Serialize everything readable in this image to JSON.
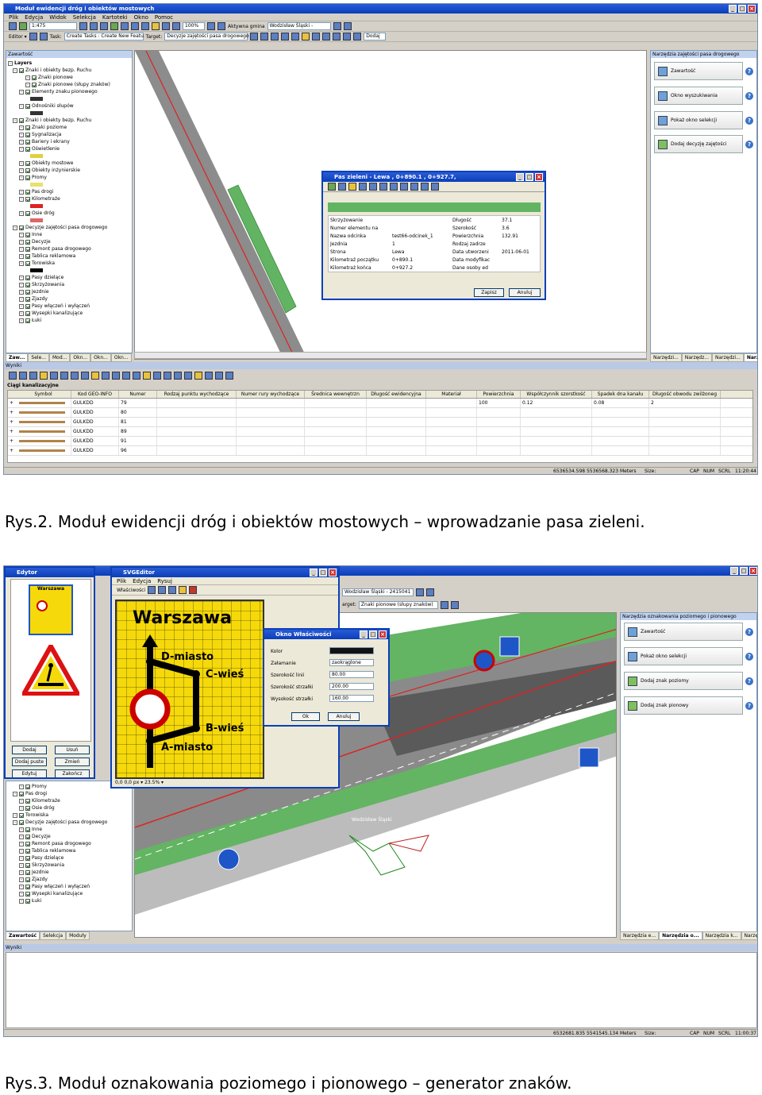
{
  "figure1": {
    "window_title": "Moduł ewidencji dróg i obiektów mostowych",
    "menu": [
      "Plik",
      "Edycja",
      "Widok",
      "Selekcja",
      "Kartoteki",
      "Okno",
      "Pomoc"
    ],
    "scale": "1:475",
    "zoom": "100%",
    "toolbar_active_gmina_label": "Aktywna gmina",
    "toolbar_active_gmina_value": "Wodzisław Śląski -",
    "editor_label": "Editor ▾",
    "task_label": "Task:",
    "task_value": "Create Tasks : Create New Featu",
    "target_label": "Target:",
    "target_value": "Decyzje zajętości pasa drogowego",
    "dodaj_label": "Dodaj",
    "toc_header": "Zawartość",
    "toc_root": "Layers",
    "toc_items": [
      "Znaki i obiekty bezp. Ruchu",
      "Znaki pionowe",
      "Znaki pionowe (słupy znaków)",
      "Elementy znaku pionowego",
      "Odnośniki słupów",
      "Znaki i obiekty bezp. Ruchu",
      "Znaki poziome",
      "Sygnalizacja",
      "Bariery i ekrany",
      "Oświetlenie",
      "Obiekty mostowe",
      "Obiekty inżynierskie",
      "Promy",
      "Pas drogi",
      "Kilometraże",
      "Osie dróg",
      "Decyzje zajętości pasa drogowego",
      "Inne",
      "Decyzje",
      "Remont pasa drogowego",
      "Tablica reklamowa",
      "Torowiska",
      "Pasy dzielące",
      "Skrzyżowania",
      "Jezdnie",
      "Zjazdy",
      "Pasy włączeń i wyłączeń",
      "Wysepki kanalizujące",
      "Łuki"
    ],
    "toc_tabs": [
      "Zaw...",
      "Sele...",
      "Mod...",
      "Okn...",
      "Okn...",
      "Okn..."
    ],
    "right_panel_title": "Narzędzia zajętości pasa drogowego",
    "right_buttons": [
      "Zawartość",
      "Okno wyszukiwania",
      "Pokaż okno selekcji",
      "Dodaj decyzję zajętości"
    ],
    "right_tabs": [
      "Narzędzi...",
      "Narzędz...",
      "Narzędzi...",
      "Narzędzi..."
    ],
    "dialog": {
      "title": "Pas zieleni - Lewa , 0+890.1 , 0+927.7,",
      "left_fields": [
        {
          "label": "Skrzyżowanie",
          "value": ""
        },
        {
          "label": "Numer elementu na",
          "value": ""
        },
        {
          "label": "Nazwa odcinka",
          "value": "test66-odcinek_1"
        },
        {
          "label": "Jezdnia",
          "value": "1"
        },
        {
          "label": "Strona",
          "value": "Lewa"
        },
        {
          "label": "Kilometraż początku",
          "value": "0+890.1"
        },
        {
          "label": "Kilometraż końca",
          "value": "0+927.2"
        }
      ],
      "right_fields": [
        {
          "label": "Długość",
          "value": "37.1"
        },
        {
          "label": "Szerokość",
          "value": "3.6"
        },
        {
          "label": "Powierzchnia",
          "value": "132.91"
        },
        {
          "label": "Rodzaj zadrze",
          "value": ""
        },
        {
          "label": "Data utworzeni",
          "value": "2011-06-01"
        },
        {
          "label": "Data modyfikac",
          "value": ""
        },
        {
          "label": "Dane osoby ed",
          "value": ""
        }
      ],
      "save_button": "Zapisz",
      "cancel_button": "Anuluj"
    },
    "results_title": "Wyniki",
    "results_layer": "Ciągi kanalizacyjne",
    "table_columns": [
      "Symbol",
      "Kod GEO-INFO",
      "Numer",
      "Rodzaj punktu wychodzące",
      "Numer rury wychodzące",
      "Średnica wewnętrzn",
      "Długość ewidencyjna",
      "Materiał",
      "Powierzchnia",
      "Współczynnik szorstkość",
      "Spadek dna kanału",
      "Długość obwodu zwilżoneg"
    ],
    "table_rows": [
      [
        "",
        "GULKDD",
        "79",
        "",
        "",
        "",
        "",
        "",
        "100",
        "0.12",
        "0.08",
        "2"
      ],
      [
        "",
        "GULKDD",
        "80",
        "",
        "",
        "",
        "",
        "",
        "",
        "",
        "",
        ""
      ],
      [
        "",
        "GULKDD",
        "81",
        "",
        "",
        "",
        "",
        "",
        "",
        "",
        "",
        ""
      ],
      [
        "",
        "GULKDD",
        "89",
        "",
        "",
        "",
        "",
        "",
        "",
        "",
        "",
        ""
      ],
      [
        "",
        "GULKDD",
        "91",
        "",
        "",
        "",
        "",
        "",
        "",
        "",
        "",
        ""
      ],
      [
        "",
        "GULKDD",
        "96",
        "",
        "",
        "",
        "",
        "",
        "",
        "",
        "",
        ""
      ]
    ],
    "status_coords": "6536534.598 5536568.323 Meters",
    "status_size": "Size:",
    "status_cap": "CAP",
    "status_num": "NUM",
    "status_scrl": "SCRL",
    "status_time": "11:20:44"
  },
  "caption1": "Rys.2. Moduł ewidencji dróg i obiektów mostowych – wprowadzanie pasa zieleni.",
  "figure2": {
    "edytor_title": "Edytor",
    "edytor_sign_city": "Warszawa",
    "edytor_buttons": [
      "Dodaj",
      "Usuń",
      "Dodaj puste",
      "Zmień",
      "Edytuj",
      "Zakończ"
    ],
    "svg_editor_title": "SVGEditor",
    "svg_menu": [
      "Plik",
      "Edycja",
      "Rysuj"
    ],
    "svg_toolbar_label": "Właściwości",
    "sign_texts": [
      "Warszawa",
      "D-miasto",
      "C-wieś",
      "B-wieś",
      "A-miasto"
    ],
    "svg_status": "0,0  0,0   px  ▾   23.5%  ▾",
    "props_dialog": {
      "title": "Okno Właściwości",
      "rows": [
        {
          "label": "Kolor",
          "value": ""
        },
        {
          "label": "Załamanie",
          "value": "zaokrąglone"
        },
        {
          "label": "Szerokość linii",
          "value": "80.00"
        },
        {
          "label": "Szerokość strzałki",
          "value": "200.00"
        },
        {
          "label": "Wysokość strzałki",
          "value": "160.00"
        }
      ],
      "ok": "Ok",
      "cancel": "Anuluj"
    },
    "toolbar_gmina": "Wodzisław Śląski - 2415041",
    "target_value": "Znaki pionowe (słupy znaków)",
    "toc_items": [
      "Promy",
      "Pas drogi",
      "Kilometraże",
      "Osie dróg",
      "Torowiska",
      "Decyzje zajętości pasa drogowego",
      "Inne",
      "Decyzje",
      "Remont pasa drogowego",
      "Tablica reklamowa",
      "Pasy dzielące",
      "Skrzyżowania",
      "Jezdnie",
      "Zjazdy",
      "Pasy włączeń i wyłączeń",
      "Wysepki kanalizujące",
      "Łuki"
    ],
    "toc_tabs": [
      "Zawartość",
      "Selekcja",
      "Moduły"
    ],
    "right_panel_title": "Narzędzia oznakowania poziomego i pionowego",
    "right_buttons": [
      "Zawartość",
      "Pokaż okno selekcji",
      "Dodaj znak poziomy",
      "Dodaj znak pionowy"
    ],
    "right_tabs": [
      "Narzędzia e...",
      "Narzędzia o...",
      "Narzędzia k...",
      "Narzędzia z..."
    ],
    "map_label": "Wodzisław Śląski",
    "results_title": "Wyniki",
    "status_coords": "6532681.835 5541545.134 Meters",
    "status_size": "Size:",
    "status_cap": "CAP",
    "status_num": "NUM",
    "status_scrl": "SCRL",
    "status_time": "11:00:37"
  },
  "caption2": "Rys.3. Moduł oznakowania poziomego i pionowego – generator znaków."
}
